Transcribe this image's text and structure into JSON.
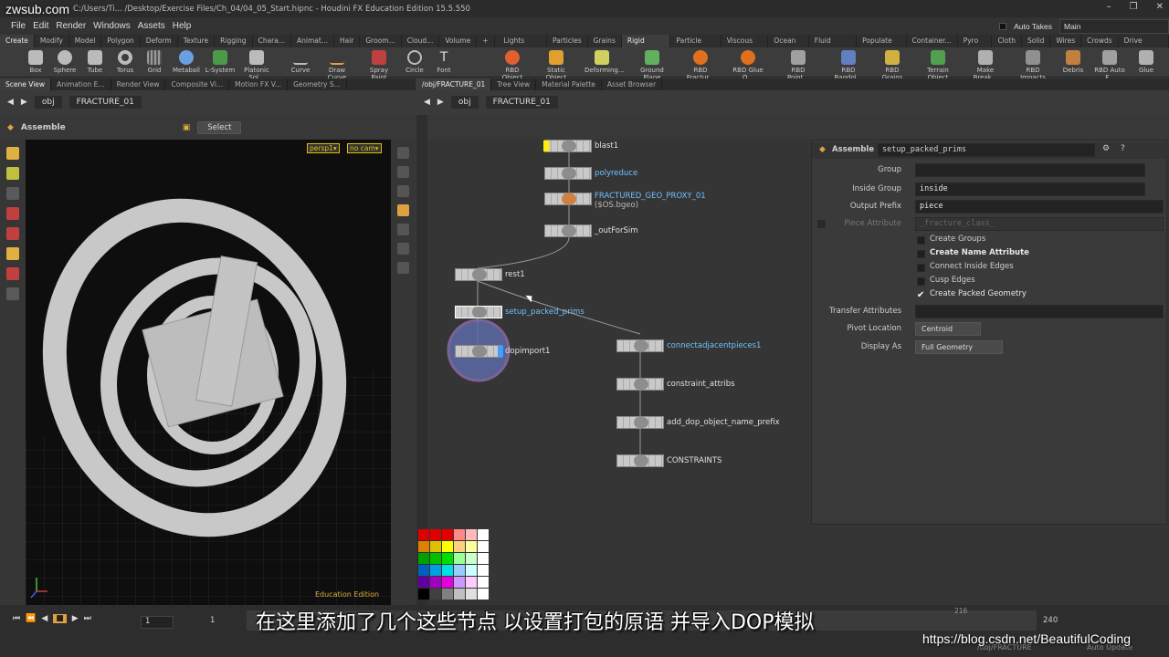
{
  "window": {
    "watermark": "zwsub.com",
    "title": "C:/Users/Ti... /Desktop/Exercise Files/Ch_04/04_05_Start.hipnc - Houdini FX Education Edition 15.5.550",
    "controls": [
      "–",
      "❐",
      "✕"
    ]
  },
  "menu": {
    "items": [
      "File",
      "Edit",
      "Render",
      "Windows",
      "Assets",
      "Help"
    ],
    "auto_takes": "Auto Takes",
    "main": "Main"
  },
  "shelf_tabs_left": [
    "Create",
    "Modify",
    "Model",
    "Polygon",
    "Deform",
    "Texture",
    "Rigging",
    "Chara...",
    "Animat...",
    "Hair",
    "Groom...",
    "Cloud...",
    "Volume"
  ],
  "shelf_tabs_right": [
    "Lights and...",
    "Particles",
    "Grains",
    "Rigid Bodies",
    "Particle Flu...",
    "Viscous Fl...",
    "Ocean FX",
    "Fluid Cont...",
    "Populate C...",
    "Container...",
    "Pyro FX",
    "Cloth",
    "Solid",
    "Wires",
    "Crowds",
    "Drive Simu..."
  ],
  "shelf_tools_left": [
    "Box",
    "Sphere",
    "Tube",
    "Torus",
    "Grid",
    "Metaball",
    "L-System",
    "Platonic Sol...",
    "Curve",
    "Draw Curve",
    "Spray Paint",
    "Circle",
    "Font"
  ],
  "shelf_tools_right": [
    "RBD Object",
    "Static Object",
    "Deforming...",
    "Ground Plane",
    "RBD Fractur...",
    "RBD Glue O...",
    "RBD Point...",
    "RBD Ragdol...",
    "RBD Grains",
    "Terrain Object",
    "Make Break...",
    "RBD Impacts",
    "Debris",
    "RBD Auto F...",
    "Glue"
  ],
  "pane_tabs_left": [
    "Scene View",
    "Animation E...",
    "Render View",
    "Composite Vi...",
    "Motion FX V...",
    "Geometry S..."
  ],
  "pane_tabs_right": [
    "/obj/FRACTURE_01",
    "Tree View",
    "Material Palette",
    "Asset Browser"
  ],
  "path": {
    "obj": "obj",
    "node": "FRACTURE_01"
  },
  "viewport": {
    "tool": "Assemble",
    "select": "Select",
    "persp": "persp1▾",
    "cam": "no cam▾",
    "edu": "Education Edition"
  },
  "network": {
    "nodes": [
      {
        "name": "blast1"
      },
      {
        "name": "polyreduce"
      },
      {
        "name": "FRACTURED_GEO_PROXY_01",
        "sub": "($OS.bgeo)"
      },
      {
        "name": "_outForSim"
      },
      {
        "name": "rest1"
      },
      {
        "name": "setup_packed_prims"
      },
      {
        "name": "dopimport1"
      },
      {
        "name": "connectadjacentpieces1"
      },
      {
        "name": "constraint_attribs"
      },
      {
        "name": "add_dop_object_name_prefix"
      },
      {
        "name": "CONSTRAINTS"
      }
    ]
  },
  "params": {
    "header_type": "Assemble",
    "header_name": "setup_packed_prims",
    "group_label": "Group",
    "group_value": "",
    "inside_group_label": "Inside Group",
    "inside_group_value": "inside",
    "output_prefix_label": "Output Prefix",
    "output_prefix_value": "piece",
    "piece_attr_label": "Piece Attribute",
    "piece_attr_value": "_fracture_class_",
    "checks": [
      {
        "label": "Create Groups",
        "checked": false
      },
      {
        "label": "Create Name Attribute",
        "checked": false
      },
      {
        "label": "Connect Inside Edges",
        "checked": false
      },
      {
        "label": "Cusp Edges",
        "checked": false
      },
      {
        "label": "Create Packed Geometry",
        "checked": true
      }
    ],
    "transfer_label": "Transfer Attributes",
    "pivot_label": "Pivot Location",
    "pivot_value": "Centroid",
    "display_label": "Display As",
    "display_value": "Full Geometry"
  },
  "timeline": {
    "frame": "1",
    "start": "1",
    "end": "240",
    "marker": "216",
    "auto_update": "Auto Update",
    "path": "/obj/FRACTURE"
  },
  "subtitle": "在这里添加了几个这些节点  以设置打包的原语  并导入DOP模拟",
  "csdn": "https://blog.csdn.net/BeautifulCoding",
  "palette_colors": [
    "#e00000",
    "#e00000",
    "#e00000",
    "#ff8888",
    "#ffbbbb",
    "#ffffff",
    "#e08000",
    "#e0c000",
    "#ffff00",
    "#ffd080",
    "#ffff99",
    "#ffffff",
    "#00a000",
    "#00c000",
    "#00e000",
    "#99ff99",
    "#ccffcc",
    "#ffffff",
    "#0060c0",
    "#00a0e0",
    "#00e0e0",
    "#99ccff",
    "#ccffff",
    "#ffffff",
    "#6000a0",
    "#a000c0",
    "#e000e0",
    "#cc99ff",
    "#ffccff",
    "#ffffff",
    "#000000",
    "#404040",
    "#808080",
    "#c0c0c0",
    "#e0e0e0",
    "#ffffff"
  ]
}
